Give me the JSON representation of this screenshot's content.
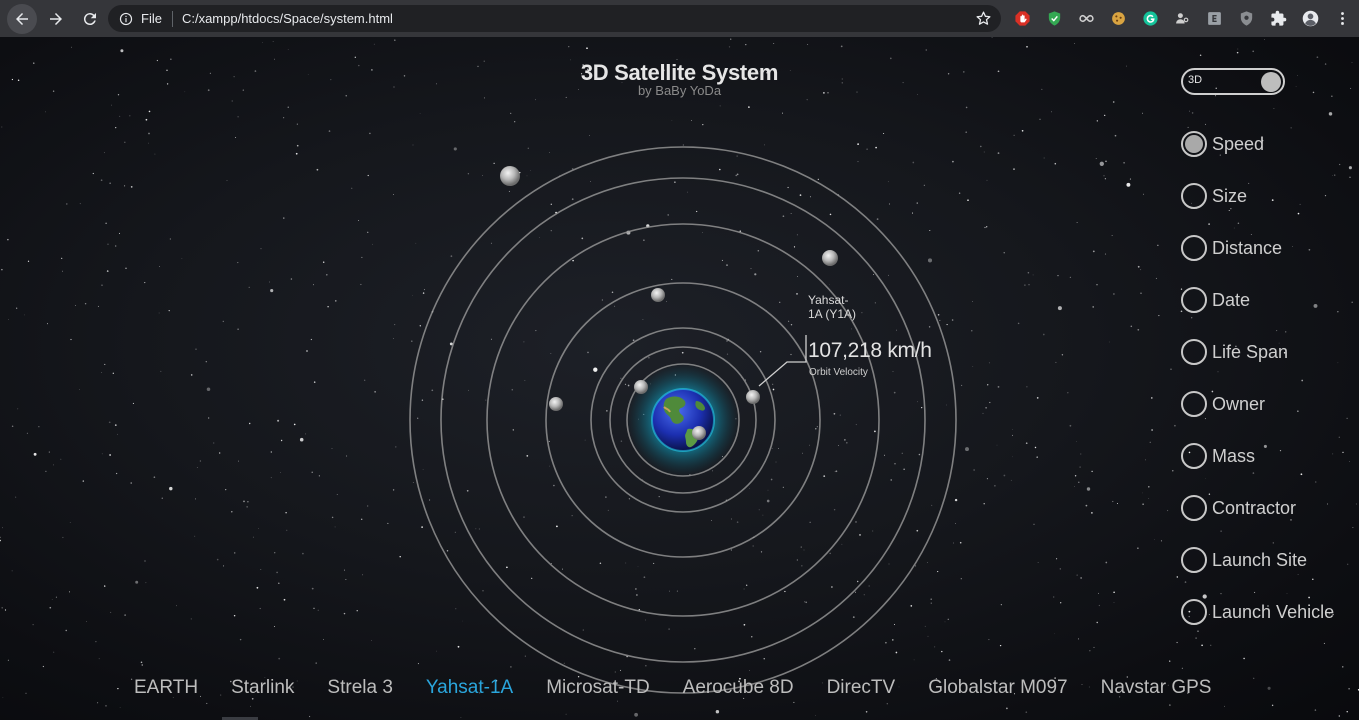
{
  "browser": {
    "scheme_label": "File",
    "url": "C:/xampp/htdocs/Space/system.html",
    "icons": [
      "back-arrow-icon",
      "forward-arrow-icon",
      "reload-icon",
      "info-icon",
      "star-icon",
      "puzzle-icon",
      "menu-dots-icon"
    ]
  },
  "page": {
    "title": "3D Satellite System",
    "subtitle": "by BaBy YoDa",
    "toggle_label": "3D",
    "tooltip": {
      "name": "Yahsat-1A (Y1A)",
      "value": "107,218 km/h",
      "label": "Orbit Velocity"
    },
    "menu": [
      {
        "label": "Speed",
        "selected": true
      },
      {
        "label": "Size",
        "selected": false
      },
      {
        "label": "Distance",
        "selected": false
      },
      {
        "label": "Date",
        "selected": false
      },
      {
        "label": "Life Span",
        "selected": false
      },
      {
        "label": "Owner",
        "selected": false
      },
      {
        "label": "Mass",
        "selected": false
      },
      {
        "label": "Contractor",
        "selected": false
      },
      {
        "label": "Launch Site",
        "selected": false
      },
      {
        "label": "Launch Vehicle",
        "selected": false
      }
    ],
    "bottom_nav": [
      {
        "label": "EARTH",
        "active": false
      },
      {
        "label": "Starlink",
        "active": false
      },
      {
        "label": "Strela 3",
        "active": false
      },
      {
        "label": "Yahsat-1A",
        "active": true
      },
      {
        "label": "Microsat-TD",
        "active": false
      },
      {
        "label": "Aerocube 8D",
        "active": false
      },
      {
        "label": "DirecTV",
        "active": false
      },
      {
        "label": "Globalstar M097",
        "active": false
      },
      {
        "label": "Navstar GPS",
        "active": false
      }
    ]
  },
  "colors": {
    "chrome_bg": "#35363a",
    "omnibox_bg": "#202124",
    "active_nav": "#2aa6dd",
    "orbit_ring": "#9a9a9a"
  }
}
